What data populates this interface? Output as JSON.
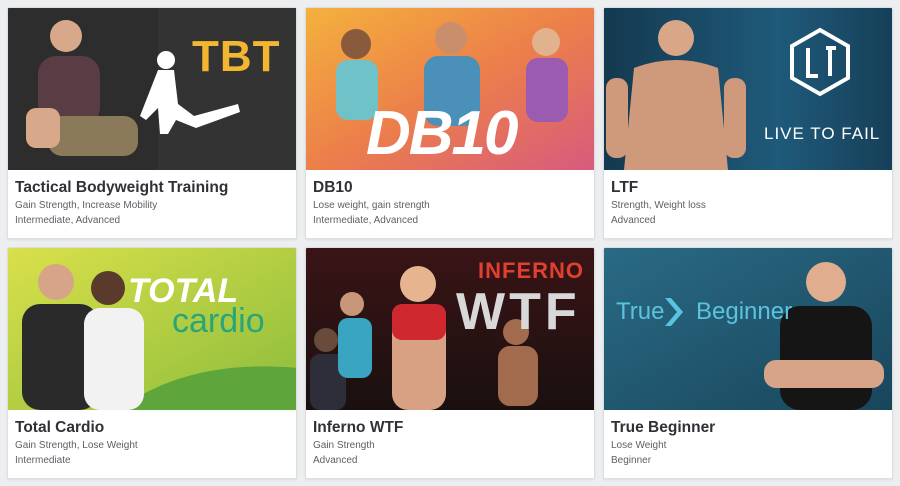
{
  "programs": [
    {
      "title": "Tactical Bodyweight Training",
      "goals": "Gain Strength, Increase Mobility",
      "level": "Intermediate, Advanced",
      "logo": "TBT",
      "accent": "#f2b631"
    },
    {
      "title": "DB10",
      "goals": "Lose weight, gain strength",
      "level": "Intermediate, Advanced",
      "logo": "DB10",
      "accent": "#e8793a"
    },
    {
      "title": "LTF",
      "goals": "Strength, Weight loss",
      "level": "Advanced",
      "logo": "LIVE TO FAIL",
      "accent": "#2a6a8e"
    },
    {
      "title": "Total Cardio",
      "goals": "Gain Strength, Lose Weight",
      "level": "Intermediate",
      "logo_line1": "TOTAL",
      "logo_line2": "cardio",
      "accent": "#c9d83a"
    },
    {
      "title": "Inferno WTF",
      "goals": "Gain Strength",
      "level": "Advanced",
      "logo_line1": "INFERNO",
      "logo_line2": "WTF",
      "accent": "#b2232a"
    },
    {
      "title": "True Beginner",
      "goals": "Lose Weight",
      "level": "Beginner",
      "logo_line1": "True",
      "logo_line2": "Beginner",
      "accent": "#2f7d95"
    }
  ]
}
